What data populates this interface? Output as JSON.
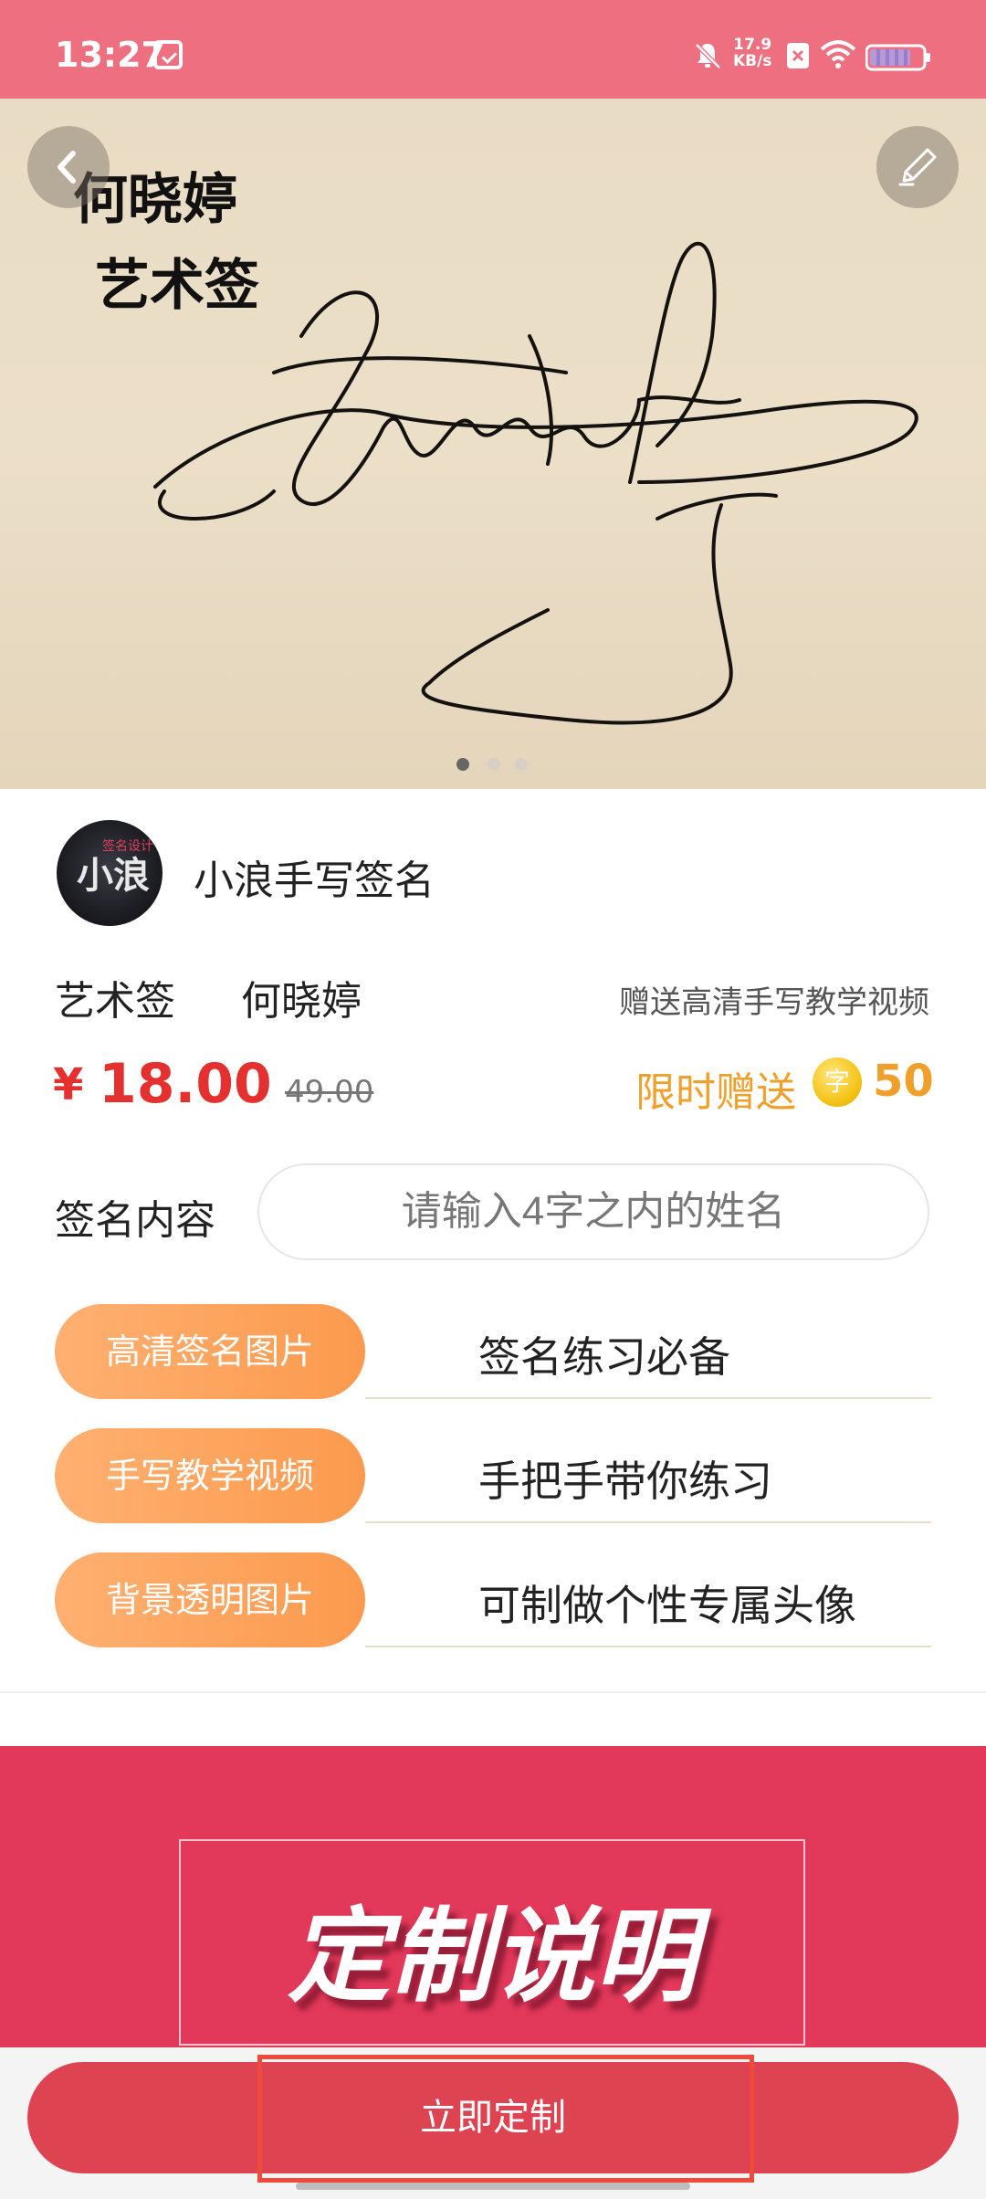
{
  "status_bar": {
    "time": "13:27",
    "net_speed_value": "17.9",
    "net_speed_unit": "KB/s",
    "battery_level": 0.75
  },
  "banner": {
    "title_line1": "何晓婷",
    "title_line2": "艺术签",
    "page_count": 3,
    "current_page": 1
  },
  "shop": {
    "name": "小浪手写签名",
    "avatar_text": "小浪",
    "avatar_subtext": "签名设计"
  },
  "product": {
    "style": "艺术签",
    "name": "何晓婷",
    "gift_text": "赠送高清手写教学视频",
    "price_symbol": "¥",
    "price": "18.00",
    "original_price": "49.00",
    "promo_text": "限时赠送",
    "coin_char": "字",
    "coin_amount": "50"
  },
  "signature_input": {
    "label": "签名内容",
    "placeholder": "请输入4字之内的姓名",
    "value": ""
  },
  "features": [
    {
      "tag": "高清签名图片",
      "desc": "签名练习必备"
    },
    {
      "tag": "手写教学视频",
      "desc": "手把手带你练习"
    },
    {
      "tag": "背景透明图片",
      "desc": "可制做个性专属头像"
    }
  ],
  "custom_banner": {
    "title": "定制说明"
  },
  "action": {
    "button_label": "立即定制"
  },
  "colors": {
    "status_bar": "#ee7080",
    "price_red": "#e53030",
    "promo_orange": "#f0a02a",
    "pill_orange": "#fb9a4e",
    "banner_red": "#e2385a",
    "button_red": "#de4352"
  }
}
